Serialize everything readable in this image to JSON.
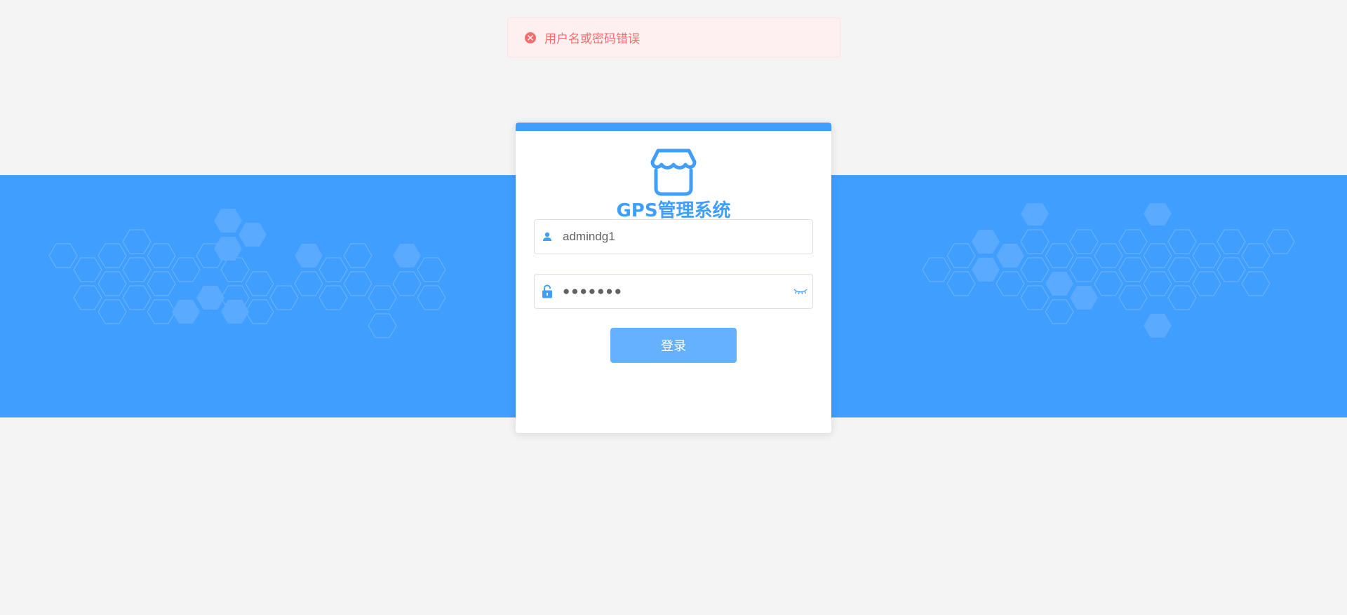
{
  "toast": {
    "icon": "close-circle-icon",
    "message": "用户名或密码错误",
    "color": "#f56c6c"
  },
  "login": {
    "logo_icon": "shop-icon",
    "title": "GPS管理系统",
    "username": {
      "icon": "user-icon",
      "value": "admindg1"
    },
    "password": {
      "icon": "lock-icon",
      "value": "●●●●●●●",
      "toggle_icon": "eye-closed-icon"
    },
    "submit_label": "登录"
  },
  "colors": {
    "primary": "#409eff",
    "button": "#66b1ff",
    "background": "#f4f4f4",
    "error": "#f56c6c"
  }
}
